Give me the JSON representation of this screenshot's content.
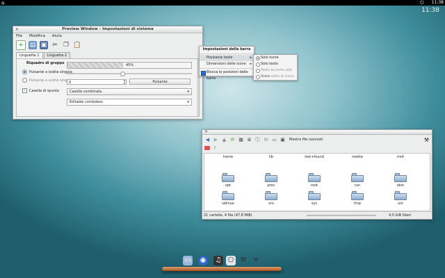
{
  "topbar": {
    "home_icon": "⌂",
    "power_icon": "⏻",
    "clock_small": "11:38"
  },
  "desktop": {
    "clock": "11:38"
  },
  "preview_window": {
    "title": "Preview Window – Impostazioni di sistema",
    "menu": [
      "File",
      "Modifica",
      "Aiuto"
    ],
    "tabs": [
      "Linguetta 1",
      "Linguetta 2"
    ],
    "group_title": "Riquadro di gruppo",
    "radio1": "Pulsante a scelta singola",
    "radio2": "Pulsante a scelta singola",
    "checkbox": "Casella di spunta",
    "progress_label": "45%",
    "progress_value": 0.45,
    "spin_value": "0",
    "push_button": "Pulsante",
    "combo1": "Casella combinata",
    "combo2": "Editable combobox"
  },
  "context_menu": {
    "header": "Impostazioni della barra",
    "items": [
      "Posizione testo",
      "Dimensioni delle icone",
      "Blocca le posizioni delle barre"
    ],
    "submenu": [
      "Solo icone",
      "Solo testo",
      "Testo accanto alle icone",
      "Testo sotto le icone"
    ]
  },
  "file_manager": {
    "show_hidden": "Mostra file nascosti",
    "path": "/",
    "rows": [
      [
        "home",
        "lib",
        "lost+found",
        "media",
        "mnt"
      ],
      [
        "opt",
        "proc",
        "root",
        "run",
        "sbin"
      ],
      [
        "selinux",
        "srv",
        "sys",
        "tmp",
        "usr"
      ]
    ],
    "status_left": "21 cartelle, 4 file (47,8 MiB)",
    "status_right": "4,0 GiB liberi"
  },
  "colors": {
    "accent": "#2a6fd0",
    "shelf": "#c9763a"
  }
}
